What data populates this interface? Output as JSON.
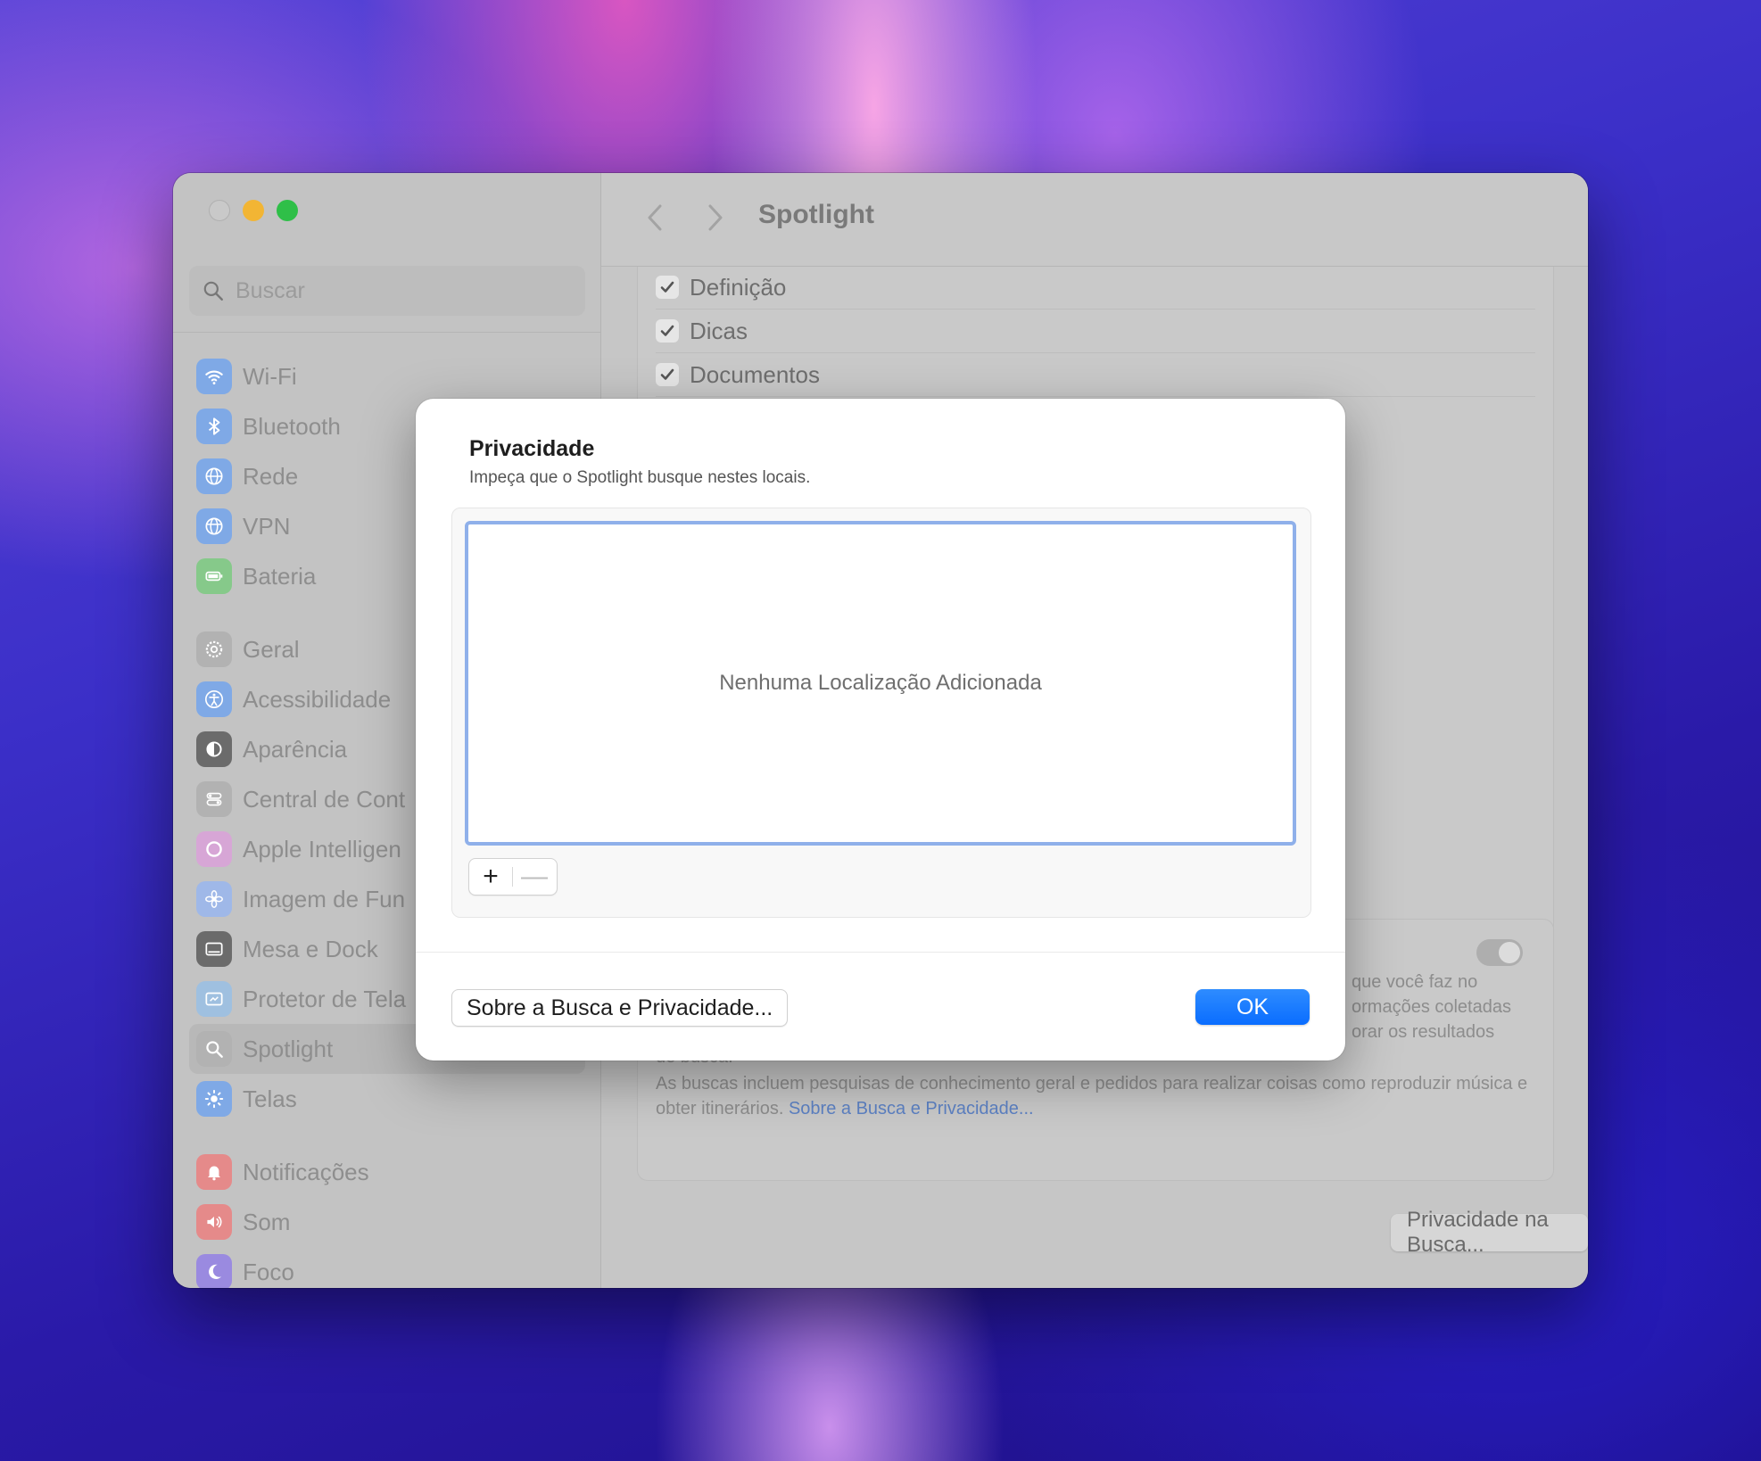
{
  "window": {
    "title": "Spotlight",
    "search_placeholder": "Buscar"
  },
  "sidebar": {
    "items": [
      {
        "label": "Wi-Fi",
        "icon": "wifi-icon",
        "color": "#7fa9e6"
      },
      {
        "label": "Bluetooth",
        "icon": "bluetooth-icon",
        "color": "#7fa9e6"
      },
      {
        "label": "Rede",
        "icon": "globe-icon",
        "color": "#7fa9e6"
      },
      {
        "label": "VPN",
        "icon": "vpn-globe-icon",
        "color": "#7fa9e6"
      },
      {
        "label": "Bateria",
        "icon": "battery-icon",
        "color": "#86c98a"
      },
      {
        "label": "Geral",
        "icon": "gear-icon",
        "color": "#b2b2b2"
      },
      {
        "label": "Acessibilidade",
        "icon": "accessibility-icon",
        "color": "#7fa9e6"
      },
      {
        "label": "Aparência",
        "icon": "appearance-icon",
        "color": "#6b6b6b"
      },
      {
        "label": "Central de Cont",
        "icon": "control-center-icon",
        "color": "#b2b2b2"
      },
      {
        "label": "Apple Intelligen",
        "icon": "apple-intelligence-icon",
        "color": "#d7a6d6"
      },
      {
        "label": "Imagem de Fun",
        "icon": "wallpaper-icon",
        "color": "#9fb8e8"
      },
      {
        "label": "Mesa e Dock",
        "icon": "dock-icon",
        "color": "#6b6b6b"
      },
      {
        "label": "Protetor de Tela",
        "icon": "screensaver-icon",
        "color": "#9fc0e0"
      },
      {
        "label": "Spotlight",
        "icon": "spotlight-icon",
        "color": "#b2b2b2"
      },
      {
        "label": "Telas",
        "icon": "display-icon",
        "color": "#7fa9e6"
      },
      {
        "label": "Notificações",
        "icon": "bell-icon",
        "color": "#e58a8a"
      },
      {
        "label": "Som",
        "icon": "speaker-icon",
        "color": "#e58a8a"
      },
      {
        "label": "Foco",
        "icon": "moon-icon",
        "color": "#9a8ae0"
      }
    ]
  },
  "main": {
    "checks": [
      {
        "label": "Definição",
        "checked": true
      },
      {
        "label": "Dicas",
        "checked": true
      },
      {
        "label": "Documentos",
        "checked": true
      }
    ],
    "privacy_text_1": "que você faz no",
    "privacy_text_1b": "ormações coletadas",
    "privacy_text_1c": "orar os resultados",
    "privacy_text_1d": "de busca.",
    "privacy_text_2": "As buscas incluem pesquisas de conhecimento geral e pedidos para realizar coisas como reproduzir música e obter itinerários.",
    "privacy_link": "Sobre a Busca e Privacidade...",
    "bottom_button": "Privacidade na Busca...",
    "help_label": "?"
  },
  "dialog": {
    "title": "Privacidade",
    "subtitle": "Impeça que o Spotlight busque nestes locais.",
    "empty_text": "Nenhuma Localização Adicionada",
    "plus_label": "+",
    "minus_label": "—",
    "about_button": "Sobre a Busca e Privacidade...",
    "ok_button": "OK"
  }
}
